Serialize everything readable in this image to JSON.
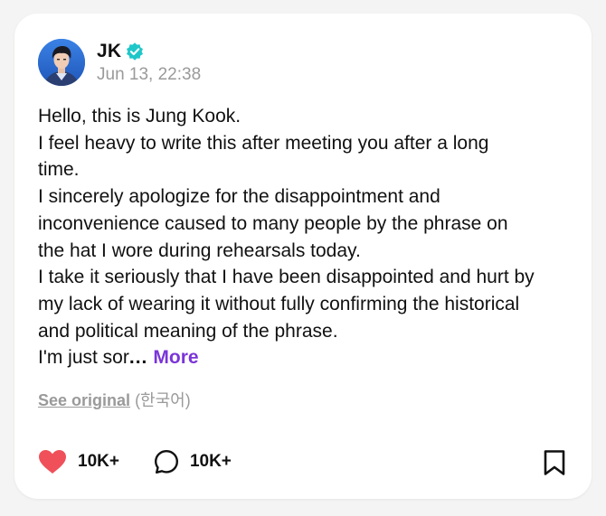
{
  "author": {
    "name": "JK",
    "verified_icon": "verified-badge-icon",
    "avatar_icon": "avatar-photo",
    "timestamp": "Jun 13, 22:38"
  },
  "post": {
    "lines": [
      "Hello, this is Jung Kook.",
      "I feel heavy to write this after meeting you after a long",
      "time.",
      "I sincerely apologize for the disappointment and",
      "inconvenience caused to many people by the phrase on",
      "the hat I wore during rehearsals today.",
      "I take it seriously that I have been disappointed and hurt by",
      "my lack of wearing it without fully confirming the historical",
      "and political meaning of the phrase."
    ],
    "truncated_line": "I'm just sor",
    "ellipsis": "...",
    "more_label": "More"
  },
  "translation": {
    "link_label": "See original",
    "language": "(한국어)"
  },
  "actions": {
    "like_icon": "heart-icon",
    "like_count": "10K+",
    "comment_icon": "comment-bubble-icon",
    "comment_count": "10K+",
    "bookmark_icon": "bookmark-icon"
  },
  "colors": {
    "accent": "#7b35d8",
    "heart": "#f0505a",
    "verified": "#1fc7c9",
    "muted_text": "#9a9a9a",
    "background": "#f4f4f5",
    "card": "#ffffff"
  }
}
